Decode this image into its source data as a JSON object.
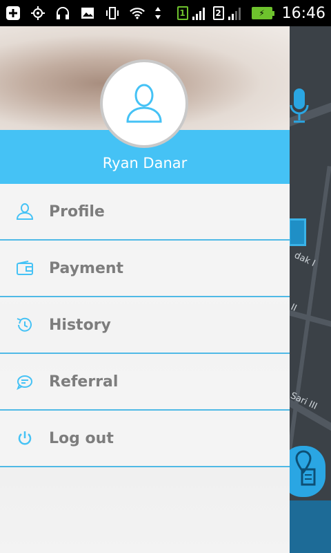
{
  "status_bar": {
    "sim1": "1",
    "sim2": "2",
    "clock": "16:46"
  },
  "drawer": {
    "user_name": "Ryan Danar",
    "menu": [
      {
        "label": "Profile",
        "icon": "person-icon"
      },
      {
        "label": "Payment",
        "icon": "wallet-icon"
      },
      {
        "label": "History",
        "icon": "history-clock-icon"
      },
      {
        "label": "Referral",
        "icon": "referral-icon"
      },
      {
        "label": "Log out",
        "icon": "power-icon"
      }
    ]
  },
  "map": {
    "labels": [
      "dak I",
      "II",
      "Sari III"
    ]
  },
  "colors": {
    "accent": "#45c2f5",
    "divider": "#4fb9e6",
    "menu_text": "#7d7d7d",
    "battery": "#6ec22d"
  }
}
